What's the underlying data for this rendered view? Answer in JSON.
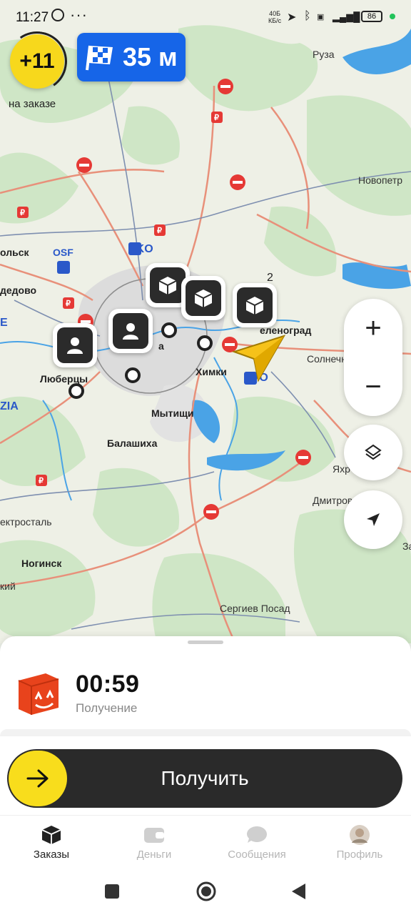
{
  "status_bar": {
    "time": "11:27",
    "speed_top": "40Б",
    "speed_bottom": "КБ/с",
    "battery": "86"
  },
  "bonus": {
    "value": "+11",
    "label": "на заказе"
  },
  "eta": {
    "value": "35 м"
  },
  "map": {
    "places": [
      "Руза",
      "Новопетр",
      "ольск",
      "OSF",
      "VKO",
      "дедово",
      "E",
      "еленоград",
      "2",
      "Солнечногорск",
      "Люберцы",
      "Химки",
      "SVO",
      "ZIA",
      "Мытищи",
      "Балашиха",
      "Яхр",
      "Дмитров",
      "ектросталь",
      "Ногинск",
      "кий",
      "За",
      "Сергиев Посад",
      "а"
    ]
  },
  "order": {
    "timer": "00:59",
    "status": "Получение"
  },
  "action": {
    "label": "Получить"
  },
  "tabs": [
    {
      "label": "Заказы",
      "icon": "orders-icon",
      "active": true
    },
    {
      "label": "Деньги",
      "icon": "wallet-icon",
      "active": false
    },
    {
      "label": "Сообщения",
      "icon": "chat-icon",
      "active": false
    },
    {
      "label": "Профиль",
      "icon": "avatar-icon",
      "active": false
    }
  ],
  "colors": {
    "accent_yellow": "#f8dd1c",
    "eta_blue": "#1665e8",
    "dark": "#2a2a2a"
  }
}
